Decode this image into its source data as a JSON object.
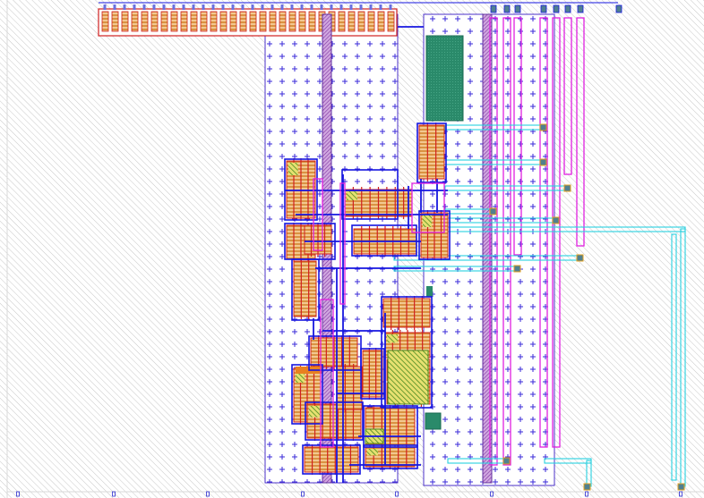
{
  "colors": {
    "background": "#ffffff",
    "hatch": "#c8c8c8",
    "nwell_outline": "#4b30c8",
    "nwell_cross": "#3a2ad8",
    "metal1": "#1616e0",
    "metal2": "#e020e0",
    "metal3": "#27d0e0",
    "poly": "#d02020",
    "diffusion_fill": "#e8a040",
    "diffusion_stripe": "#c87020",
    "active_green": "#7aa020",
    "pad_teal": "#2a8a6a",
    "contact": "#3a7ae0",
    "via": "#508090",
    "pin": "#6a70e0"
  },
  "view": {
    "layer_legend": []
  }
}
